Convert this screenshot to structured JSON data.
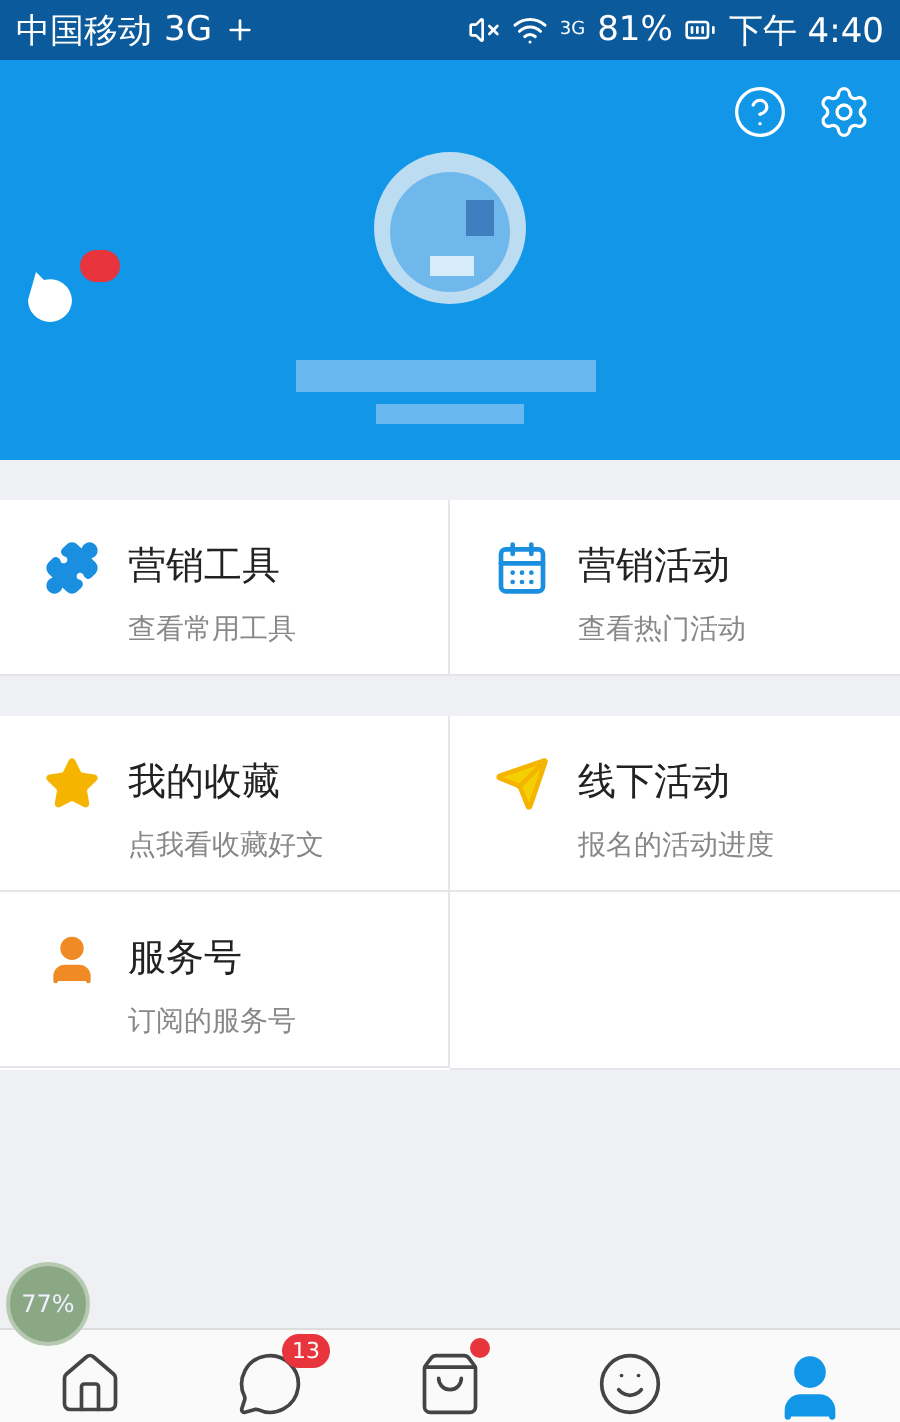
{
  "status_bar": {
    "carrier": "中国移动",
    "network": "3G",
    "signal_label": "3G",
    "battery": "81%",
    "time": "下午 4:40"
  },
  "header": {
    "pet_badge": true
  },
  "sections": [
    [
      {
        "kind": "puzzle",
        "title": "营销工具",
        "subtitle": "查看常用工具"
      },
      {
        "kind": "calendar",
        "title": "营销活动",
        "subtitle": "查看热门活动"
      }
    ],
    [
      {
        "kind": "star",
        "title": "我的收藏",
        "subtitle": "点我看收藏好文"
      },
      {
        "kind": "plane",
        "title": "线下活动",
        "subtitle": "报名的活动进度"
      },
      {
        "kind": "person",
        "title": "服务号",
        "subtitle": "订阅的服务号"
      }
    ]
  ],
  "float_widget": {
    "text": "77%"
  },
  "nav": [
    {
      "kind": "home",
      "selected": false
    },
    {
      "kind": "chat",
      "selected": false,
      "badge": "13"
    },
    {
      "kind": "bag",
      "selected": false,
      "dot": true
    },
    {
      "kind": "bot",
      "selected": false
    },
    {
      "kind": "profile",
      "selected": true
    }
  ]
}
